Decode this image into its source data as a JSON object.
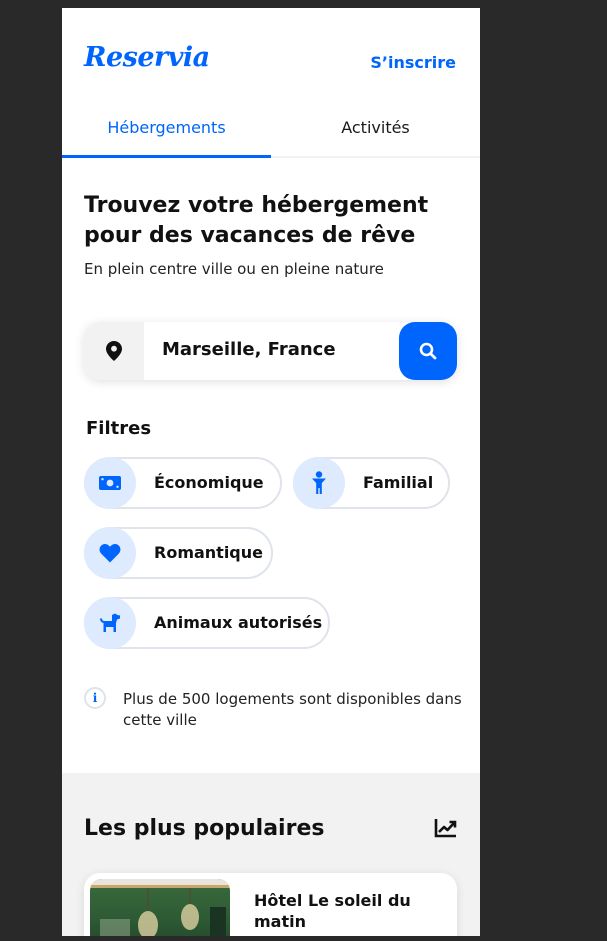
{
  "app": {
    "name": "Reservia",
    "signup": "S’inscrire"
  },
  "tabs": [
    {
      "label": "Hébergements",
      "active": true
    },
    {
      "label": "Activités",
      "active": false
    }
  ],
  "hero": {
    "title": "Trouvez votre hébergement pour des vacances de rêve",
    "subtitle": "En plein centre ville ou en pleine nature"
  },
  "search": {
    "value": "Marseille, France",
    "pin_icon": "map-pin-icon",
    "button_icon": "search-icon"
  },
  "filters": {
    "title": "Filtres",
    "items": [
      {
        "label": "Économique",
        "icon": "money-icon"
      },
      {
        "label": "Familial",
        "icon": "child-icon"
      },
      {
        "label": "Romantique",
        "icon": "heart-icon"
      },
      {
        "label": "Animaux autorisés",
        "icon": "dog-icon"
      }
    ]
  },
  "info": {
    "text": "Plus de 500 logements sont disponibles dans cette ville",
    "icon_text": "i"
  },
  "popular": {
    "title": "Les plus populaires",
    "trend_icon": "chart-line-icon",
    "cards": [
      {
        "name": "Hôtel Le soleil du matin"
      }
    ]
  },
  "colors": {
    "accent": "#0065fc",
    "chip_icon_bg": "#deebff",
    "section_bg": "#f2f2f2",
    "backdrop": "#292929"
  }
}
